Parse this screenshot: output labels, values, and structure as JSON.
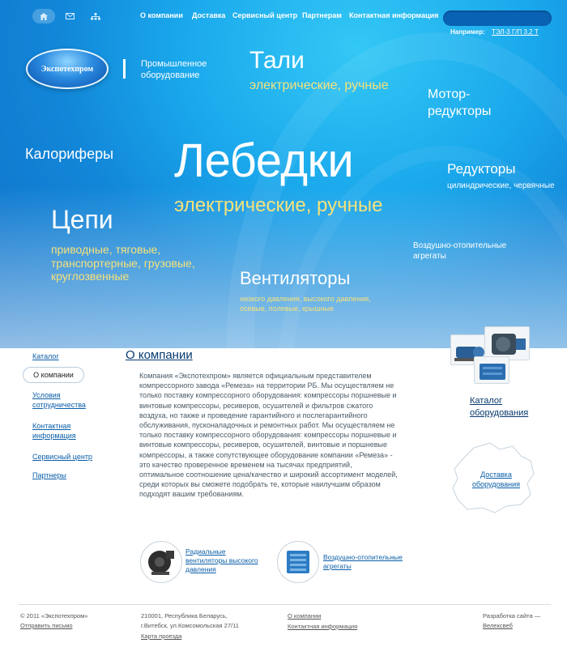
{
  "header": {
    "icons": [
      "home-icon",
      "mail-icon",
      "sitemap-icon"
    ],
    "nav": [
      "О компании",
      "Доставка",
      "Сервисный центр",
      "Партнерам",
      "Контактная информация"
    ],
    "search_placeholder": "",
    "example_label": "Например:",
    "example_value": "ТЭЛ-3 Г/П 3,2 Т"
  },
  "logo": {
    "text": "Экспотехпром",
    "tagline": "Промышленное оборудование"
  },
  "hero": {
    "tali": "Тали",
    "tali_sub": "электрические, ручные",
    "motor": "Мотор-\nредукторы",
    "kalorifery": "Калориферы",
    "lebedki": "Лебедки",
    "lebedki_sub": "электрические, ручные",
    "reduktory": "Редукторы",
    "reduktory_sub": "цилиндрические, червячные",
    "tsepi": "Цепи",
    "tsepi_sub": "приводные, тяговые, транспортерные, грузовые, круглозвенные",
    "vozdush": "Воздушно-отопительные агрегаты",
    "ventilatory": "Вентиляторы",
    "ventilatory_sub": "низкого давления, высокого давления, осевые, полевые, крышные"
  },
  "sidebar": {
    "items": [
      "Каталог",
      "О компании",
      "Условия сотрудничества",
      "Контактная информация",
      "Сервисный центр",
      "Партнеры"
    ],
    "active": "О компании"
  },
  "content": {
    "title": "О компании",
    "text": "Компания «Экспотехпром» является официальным представителем компрессорного завода «Ремеза» на территории РБ. Мы осуществляем не только поставку компрессорного оборудования: компрессоры поршневые и винтовые компрессоры, ресиверов, осушителей и фильтров сжатого воздуха, но также и проведение гарантийного и послегарантийного обслуживания, пусконаладочных и ремонтных работ. Мы осуществляем не только поставку компрессорного оборудования: компрессоры поршневые и винтовые компрессоры, ресиверов, осушителей, винтовые и поршневые компрессоры, а также сопутствующее оборудование компании «Ремеза» - это качество проверенное временем на тысячах предприятий, оптимальное соотношение цена/качество и широкий ассортимент моделей, среди которых вы сможете подобрать те, которые наилучшим образом подходят вашим требованиям."
  },
  "right": {
    "catalog": "Каталог оборудования",
    "delivery": "Доставка оборудования"
  },
  "products": [
    {
      "label": "Радиальные вентиляторы высокого давления"
    },
    {
      "label": "Воздушно-отопительные агрегаты"
    }
  ],
  "footer": {
    "copyright": "© 2011 «Экспотехпром»",
    "send_mail": "Отправить письмо",
    "address1": "210001, Республика Беларусь,",
    "address2": "г.Витебск, ул.Комсомольская 27/11",
    "map": "Карта проезда",
    "about": "О компании",
    "contacts": "Контактная информация",
    "dev_label": "Разработка сайта —",
    "dev_link": "Велексвеб"
  },
  "colors": {
    "hero_dark": "#0f6fc8",
    "hero_light": "#33c8f5",
    "accent_yellow": "#f6e27a",
    "link": "#0b5ea8"
  }
}
